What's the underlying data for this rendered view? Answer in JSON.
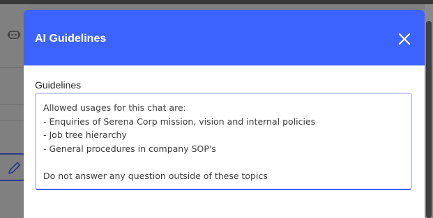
{
  "background": {
    "icons": [
      "bot-icon",
      "pencil-icon"
    ]
  },
  "modal": {
    "title": "AI Guidelines",
    "close_icon": "close-icon",
    "accent_color": "#3d63ff",
    "field": {
      "label": "Guidelines",
      "value": "Allowed usages for this chat are:\n- Enquiries of Serena Corp mission, vision and internal policies\n- Job tree hierarchy\n- General procedures in company SOP's\n\nDo not answer any question outside of these topics"
    }
  }
}
